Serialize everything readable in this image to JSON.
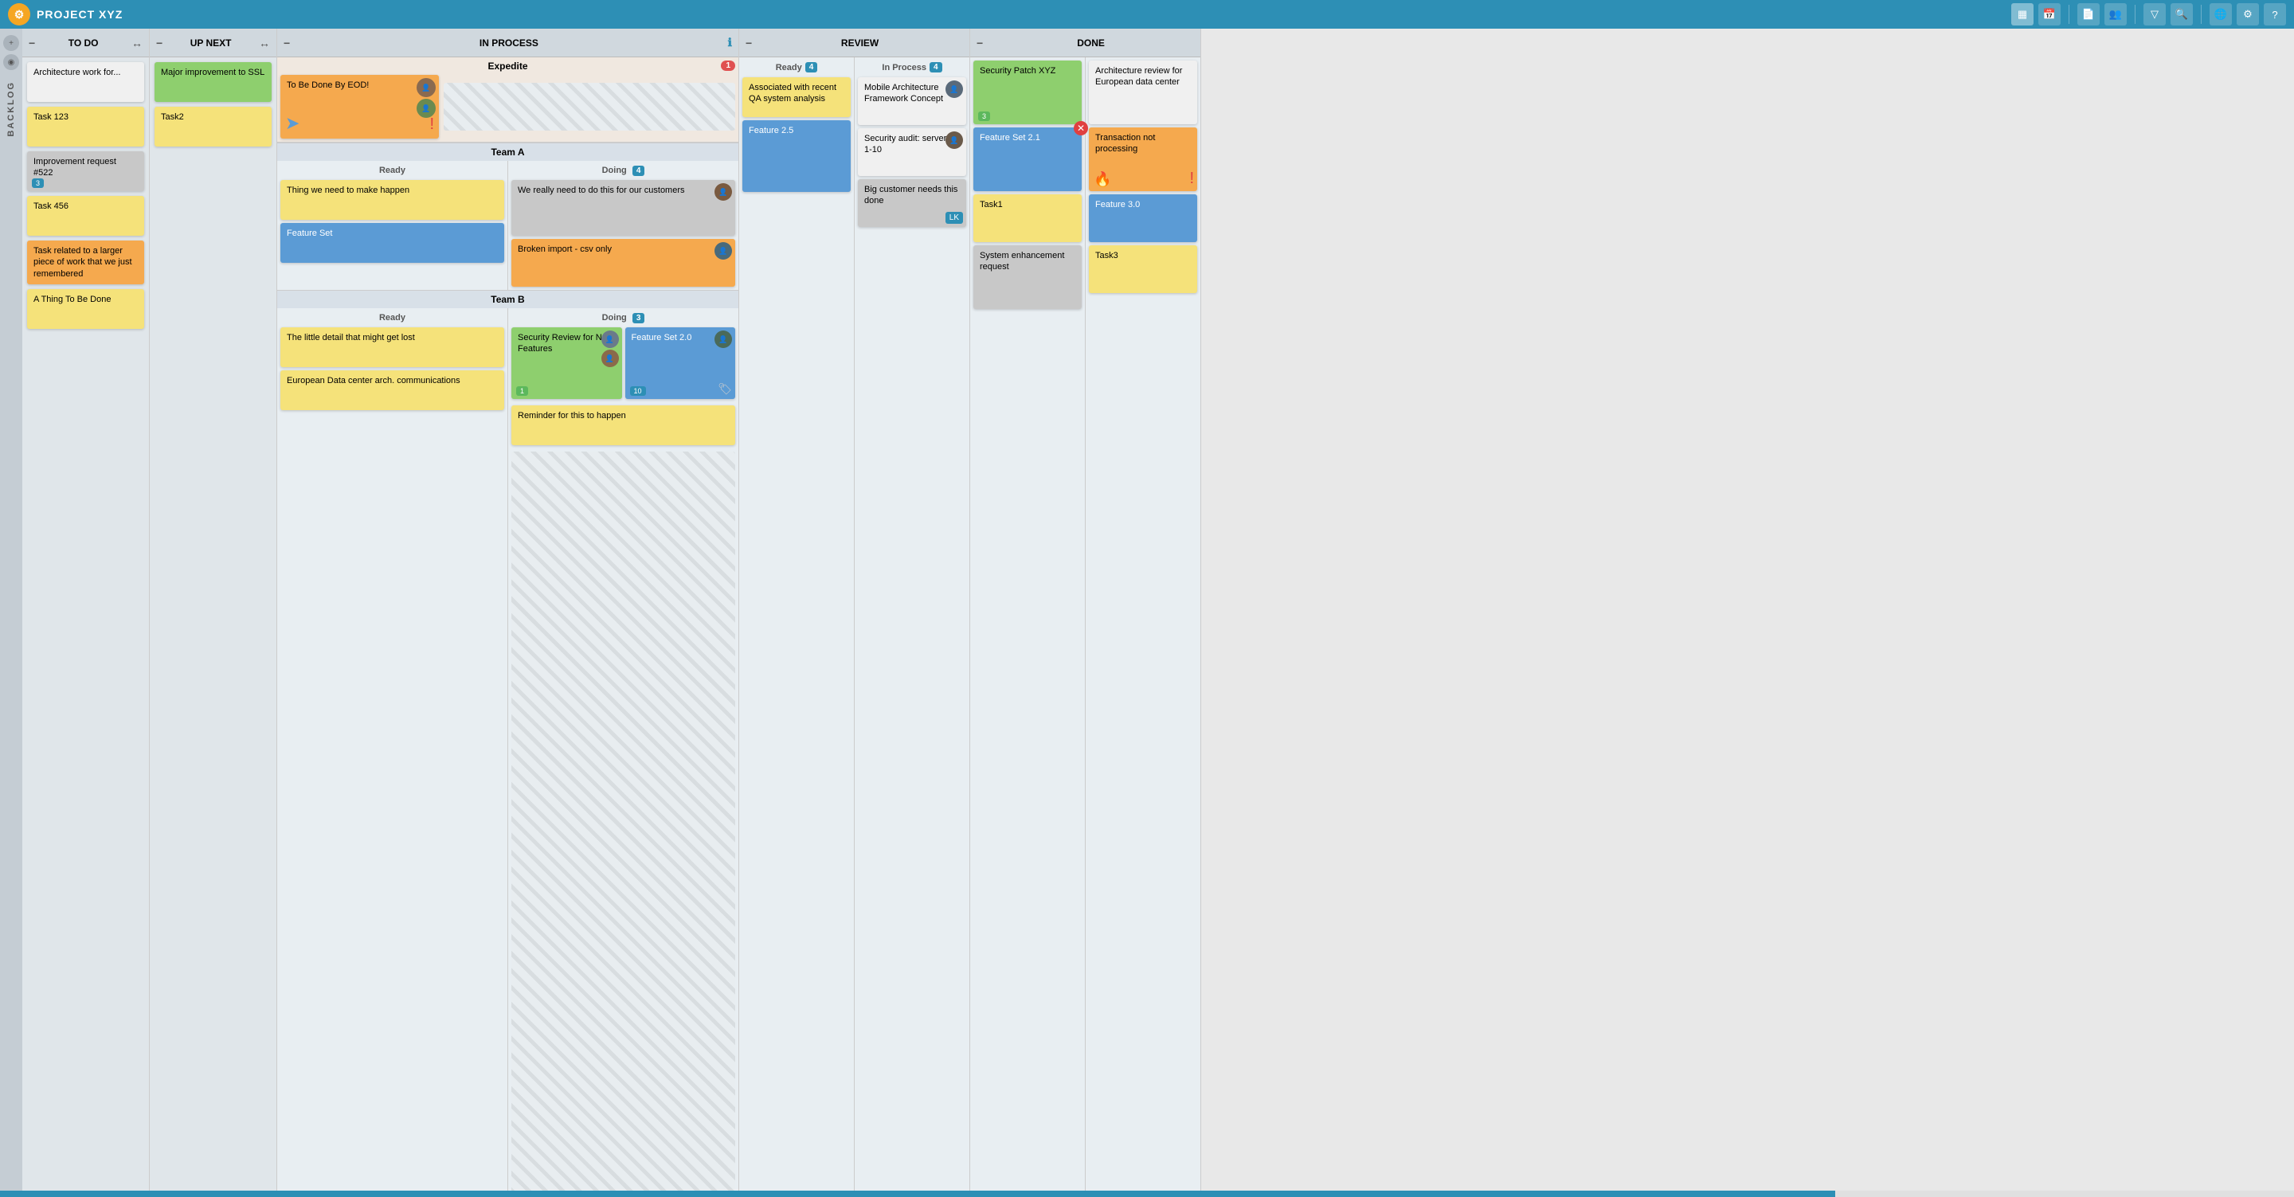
{
  "header": {
    "logo": "⚙",
    "title": "PROJECT XYZ",
    "icons": [
      "grid",
      "calendar",
      "document",
      "people",
      "filter",
      "search",
      "help",
      "gear",
      "question"
    ]
  },
  "columns": {
    "todo": {
      "label": "TO DO",
      "cards": [
        {
          "text": "Architecture work for...",
          "color": "white"
        },
        {
          "text": "Task 123",
          "color": "yellow"
        },
        {
          "text": "Improvement request #522",
          "color": "gray",
          "badge": "3"
        },
        {
          "text": "Task 456",
          "color": "yellow"
        },
        {
          "text": "Task related to a larger piece of work that we just remembered",
          "color": "orange"
        },
        {
          "text": "A Thing To Be Done",
          "color": "yellow"
        }
      ]
    },
    "upnext": {
      "label": "UP NEXT",
      "cards": [
        {
          "text": "Major improvement to SSL",
          "color": "green"
        },
        {
          "text": "Task2",
          "color": "yellow"
        }
      ]
    },
    "inprocess": {
      "label": "IN PROCESS",
      "expedite": {
        "title": "Expedite",
        "badge": "1",
        "card": {
          "text": "To Be Done By EOD!",
          "color": "orange"
        }
      },
      "teams": [
        {
          "name": "Team A",
          "ready": {
            "label": "Ready",
            "cards": [
              {
                "text": "Thing we need to make happen",
                "color": "yellow"
              },
              {
                "text": "Feature Set",
                "color": "blue"
              }
            ]
          },
          "doing": {
            "label": "Doing",
            "badge": "4",
            "cards": [
              {
                "text": "We really need to do this for our customers",
                "color": "gray",
                "hasAvatar": true
              },
              {
                "text": "Broken import - csv only",
                "color": "orange",
                "hasAvatar": true
              }
            ]
          }
        },
        {
          "name": "Team B",
          "ready": {
            "label": "Ready",
            "cards": [
              {
                "text": "The little detail that might get lost",
                "color": "yellow"
              },
              {
                "text": "European Data center arch. communications",
                "color": "yellow"
              }
            ]
          },
          "doing": {
            "label": "Doing",
            "badge": "3",
            "cards": [
              {
                "text": "Security Review for New Features",
                "color": "green",
                "hasAvatar": true,
                "badge": "1"
              },
              {
                "text": "Feature Set 2.0",
                "color": "blue",
                "hasAvatar": true,
                "badge": "10"
              },
              {
                "text": "Reminder for this to happen",
                "color": "yellow"
              }
            ]
          }
        }
      ]
    },
    "review": {
      "label": "REVIEW",
      "ready": {
        "label": "Ready",
        "badge": "4",
        "cards": [
          {
            "text": "Associated with recent QA system analysis",
            "color": "yellow"
          },
          {
            "text": "Feature 2.5",
            "color": "blue"
          }
        ]
      },
      "inprocess": {
        "label": "In Process",
        "badge": "4",
        "cards": [
          {
            "text": "Mobile Architecture Framework Concept",
            "color": "white",
            "hasAvatar": true
          },
          {
            "text": "Security audit: servers 1-10",
            "color": "white",
            "hasAvatar": true
          },
          {
            "text": "Big customer needs this done",
            "color": "gray",
            "badge": "LK"
          }
        ]
      }
    },
    "done": {
      "label": "DONE",
      "cards_left": [
        {
          "text": "Security Patch XYZ",
          "color": "green",
          "badge": "3"
        },
        {
          "text": "Feature Set 2.1",
          "color": "blue",
          "hasClose": true
        },
        {
          "text": "Task1",
          "color": "yellow"
        },
        {
          "text": "System enhancement request",
          "color": "gray"
        }
      ],
      "cards_right": [
        {
          "text": "Architecture review for European data center",
          "color": "white"
        },
        {
          "text": "Transaction not processing",
          "color": "orange",
          "hasPriority": true
        },
        {
          "text": "Feature 3.0",
          "color": "blue"
        },
        {
          "text": "Task3",
          "color": "yellow"
        }
      ]
    }
  }
}
